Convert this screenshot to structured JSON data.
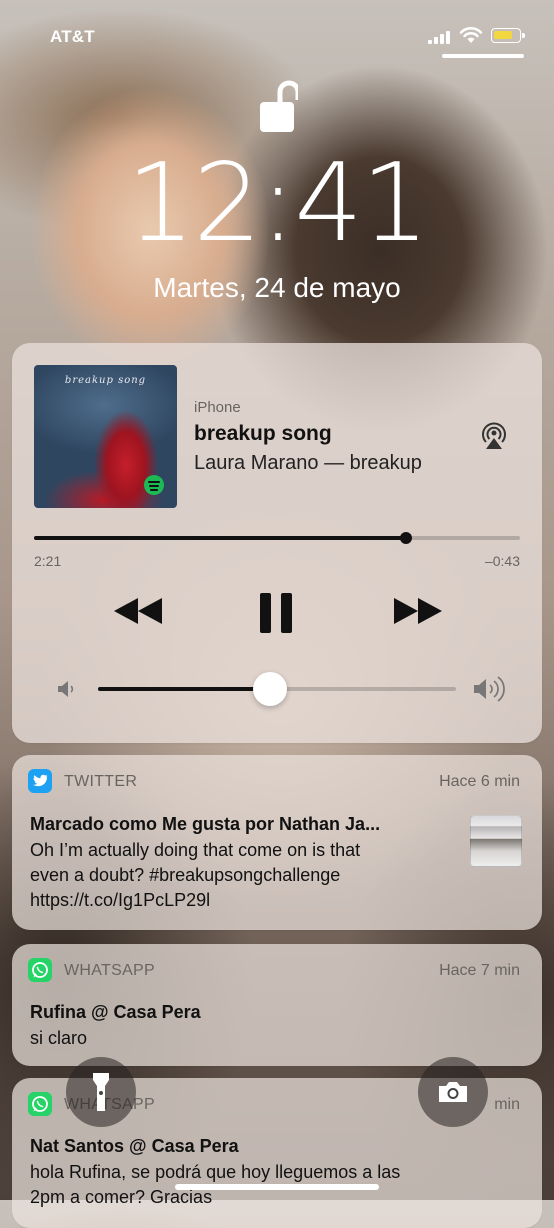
{
  "status_bar": {
    "carrier": "AT&T",
    "battery_color": "#f2d740"
  },
  "lock": {
    "time": "12:41",
    "date": "Martes, 24 de mayo",
    "lock_icon": "unlocked-padlock-icon"
  },
  "media_player": {
    "album_art_title": "breakup song",
    "source": "iPhone",
    "song": "breakup song",
    "artist_album": "Laura Marano — breakup",
    "elapsed": "2:21",
    "remaining": "–0:43",
    "progress_fraction": 0.765,
    "volume_fraction": 0.48,
    "icons": [
      "airplay-icon",
      "rewind-icon",
      "pause-icon",
      "fast-forward-icon",
      "volume-low-icon",
      "volume-high-icon",
      "spotify-icon"
    ]
  },
  "notifications": [
    {
      "app": "TWITTER",
      "time": "Hace 6 min",
      "title": "Marcado como Me gusta por Nathan Ja...",
      "body_lines": [
        "Oh I’m actually doing that come on is that",
        "even a doubt? #breakupsongchallenge",
        "https://t.co/Ig1PcLP29l"
      ],
      "accent": "#1da1f2"
    },
    {
      "app": "WHATSAPP",
      "time": "Hace 7 min",
      "title": "Rufina @ Casa Pera",
      "body_lines": [
        "si claro"
      ],
      "accent": "#25d366"
    },
    {
      "app": "WHATSAPP",
      "time": "min",
      "title": "Nat Santos @ Casa Pera",
      "body_lines": [
        "hola Rufina, se podrá que hoy lleguemos a las",
        "2pm a comer? Gracias"
      ],
      "accent": "#25d366"
    }
  ],
  "quick_actions": {
    "left": "flashlight-icon",
    "right": "camera-icon"
  }
}
